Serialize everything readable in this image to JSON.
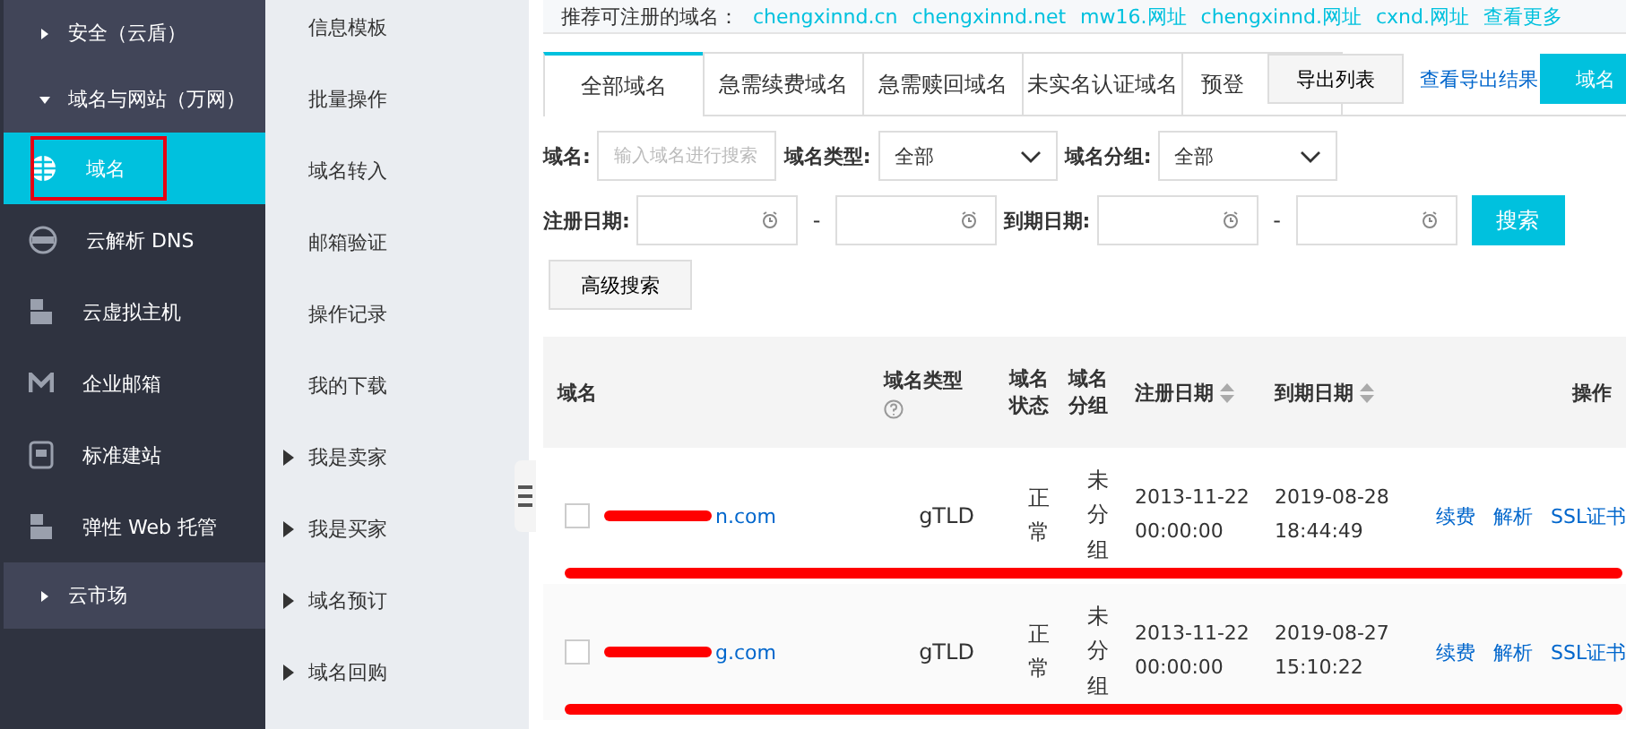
{
  "sidebar": {
    "items": [
      {
        "kind": "group",
        "label": "安全（云盾）",
        "expanded": false
      },
      {
        "kind": "group",
        "label": "域名与网站（万网）",
        "expanded": true
      },
      {
        "kind": "item",
        "label": "域名",
        "selected": true
      },
      {
        "kind": "item",
        "label": "云解析 DNS",
        "selected": false
      },
      {
        "kind": "item",
        "label": "云虚拟主机",
        "selected": false
      },
      {
        "kind": "item",
        "label": "企业邮箱",
        "selected": false
      },
      {
        "kind": "item",
        "label": "标准建站",
        "selected": false
      },
      {
        "kind": "item",
        "label": "弹性 Web 托管",
        "selected": false
      },
      {
        "kind": "group",
        "label": "云市场",
        "expanded": false
      }
    ]
  },
  "submenu": {
    "items": [
      {
        "label": "信息模板",
        "has_children": false
      },
      {
        "label": "批量操作",
        "has_children": false
      },
      {
        "label": "域名转入",
        "has_children": false
      },
      {
        "label": "邮箱验证",
        "has_children": false
      },
      {
        "label": "操作记录",
        "has_children": false
      },
      {
        "label": "我的下载",
        "has_children": false
      },
      {
        "label": "我是卖家",
        "has_children": true
      },
      {
        "label": "我是买家",
        "has_children": true
      },
      {
        "label": "域名预订",
        "has_children": true
      },
      {
        "label": "域名回购",
        "has_children": true
      }
    ]
  },
  "suggest": {
    "label": "推荐可注册的域名：",
    "links": [
      "chengxinnd.cn",
      "chengxinnd.net",
      "mw16.网址",
      "chengxinnd.网址",
      "cxnd.网址",
      "查看更多"
    ]
  },
  "tabs": [
    {
      "label": "全部域名",
      "selected": true
    },
    {
      "label": "急需续费域名",
      "selected": false
    },
    {
      "label": "急需赎回域名",
      "selected": false
    },
    {
      "label": "未实名认证域名",
      "selected": false
    },
    {
      "label": "预登",
      "selected": false
    }
  ],
  "export_button": "导出列表",
  "export_link": "查看导出结果",
  "domain_button": "域名",
  "filters": {
    "domain_label": "域名:",
    "domain_placeholder": "输入域名进行搜索",
    "type_label": "域名类型:",
    "type_value": "全部",
    "group_label": "域名分组:",
    "group_value": "全部",
    "reg_label": "注册日期:",
    "dash": "-",
    "exp_label": "到期日期:",
    "search_button": "搜索",
    "advanced_button": "高级搜索"
  },
  "table": {
    "columns": [
      "域名",
      "域名类型",
      "域名状态",
      "域名分组",
      "注册日期",
      "到期日期",
      "操作"
    ],
    "rows": [
      {
        "checked": false,
        "domain": "n.com",
        "type": "gTLD",
        "status": "正常",
        "group": "未分组",
        "reg": "2013-11-22 00:00:00",
        "exp": "2019-08-28 18:44:49",
        "actions": [
          "续费",
          "解析",
          "SSL证书"
        ]
      },
      {
        "checked": false,
        "domain": "g.com",
        "type": "gTLD",
        "status": "正常",
        "group": "未分组",
        "reg": "2013-11-22 00:00:00",
        "exp": "2019-08-27 15:10:22",
        "actions": [
          "续费",
          "解析",
          "SSL证书"
        ]
      }
    ]
  }
}
